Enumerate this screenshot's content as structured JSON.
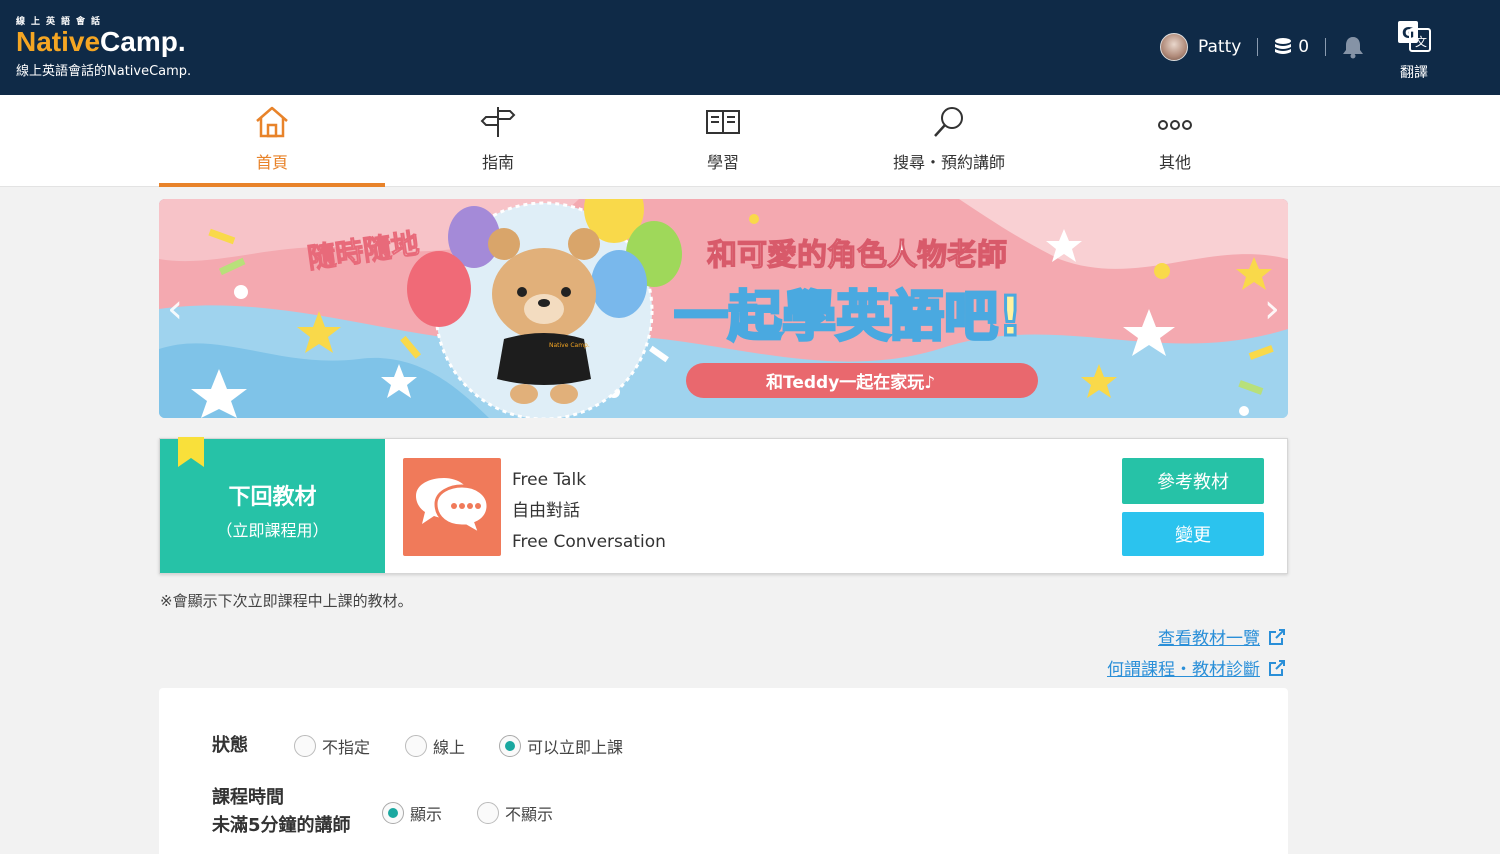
{
  "header": {
    "logo_small": "線上英語會話",
    "logo_native": "Native",
    "logo_camp": "Camp.",
    "tagline": "線上英語會話的NativeCamp.",
    "user_name": "Patty",
    "coins": "0",
    "translate_label": "翻譯"
  },
  "nav": [
    {
      "label": "首頁",
      "icon": "home-icon",
      "active": true
    },
    {
      "label": "指南",
      "icon": "signpost-icon",
      "active": false
    },
    {
      "label": "學習",
      "icon": "book-icon",
      "active": false
    },
    {
      "label": "搜尋・預約講師",
      "icon": "search-icon",
      "active": false
    },
    {
      "label": "其他",
      "icon": "more-icon",
      "active": false
    }
  ],
  "banner": {
    "tag": "隨時隨地",
    "line1": "和可愛的角色人物老師",
    "line2": "一起學英語吧!",
    "button": "和Teddy一起在家玩♪",
    "bear_shirt": "Native Camp."
  },
  "next_material": {
    "title": "下回教材",
    "subtitle": "（立即課程用）",
    "lines": [
      "Free Talk",
      "自由對話",
      "Free Conversation"
    ],
    "ref_button": "參考教材",
    "change_button": "變更"
  },
  "note": "※會顯示下次立即課程中上課的教材。",
  "links": {
    "materials_list": "查看教材一覽",
    "diagnosis": "何謂課程・教材診斷"
  },
  "filters": {
    "status_label": "狀態",
    "status_options": [
      "不指定",
      "線上",
      "可以立即上課"
    ],
    "status_selected": 2,
    "time_label_1": "課程時間",
    "time_label_2": "未滿5分鐘的講師",
    "time_options": [
      "顯示",
      "不顯示"
    ],
    "time_selected": 0
  },
  "colors": {
    "header_bg": "#0f2a47",
    "accent_orange": "#e8832a",
    "teal": "#26c2a7",
    "cyan": "#2bc3ee",
    "link": "#2a8fd8"
  }
}
